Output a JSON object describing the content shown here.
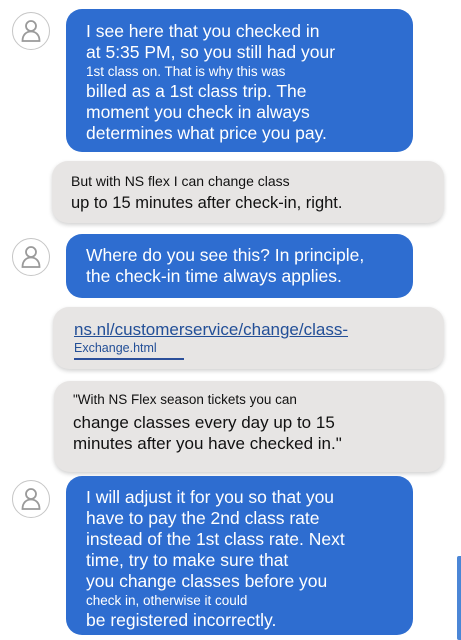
{
  "conversation": {
    "messages": [
      {
        "sender": "agent",
        "avatar_icon": "user-avatar-icon",
        "lines": [
          "I see here that you checked in",
          "at 5:35 PM, so you still had your",
          "1st class on. That is why this was",
          "billed as a 1st class trip. The",
          "moment you check in always",
          "determines what price you pay."
        ]
      },
      {
        "sender": "user",
        "lines": [
          "But with NS flex I can change class",
          "up to 15 minutes after check-in, right."
        ]
      },
      {
        "sender": "agent",
        "avatar_icon": "user-avatar-icon",
        "lines": [
          "Where do you see this? In principle,",
          "the check-in time always applies."
        ]
      },
      {
        "sender": "user",
        "link_lines": [
          "ns.nl/customerservice/change/class-",
          "Exchange.html"
        ]
      },
      {
        "sender": "user",
        "lines": [
          "\"With NS Flex season tickets you can",
          "change classes every day up to 15",
          "minutes after you have checked in.\""
        ]
      },
      {
        "sender": "agent",
        "avatar_icon": "user-avatar-icon",
        "lines": [
          "I will adjust it for you so that you",
          "have to pay the 2nd class rate",
          "instead of the 1st class rate. Next",
          "time, try to make sure that",
          "you change classes before you",
          "check in, otherwise it could",
          "be registered incorrectly."
        ]
      }
    ]
  },
  "colors": {
    "agent_bubble": "#2e6dd0",
    "user_bubble": "#e7e5e4",
    "link": "#234f97"
  }
}
